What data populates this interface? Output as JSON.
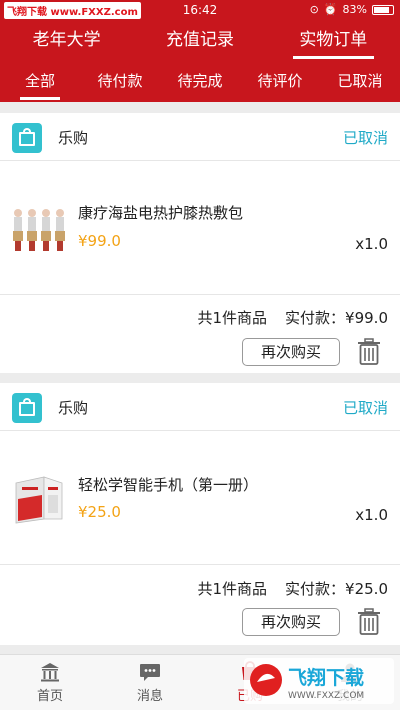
{
  "status_bar": {
    "watermark": "飞翔下载 www.FXXZ.com",
    "time": "16:42",
    "battery": "83%",
    "battery_level": 0.83
  },
  "top_tabs": [
    {
      "label": "老年大学"
    },
    {
      "label": "充值记录"
    },
    {
      "label": "实物订单",
      "active": true
    }
  ],
  "sub_tabs": [
    {
      "label": "全部",
      "active": true
    },
    {
      "label": "待付款"
    },
    {
      "label": "待完成"
    },
    {
      "label": "待评价"
    },
    {
      "label": "已取消"
    }
  ],
  "orders": [
    {
      "shop": "乐购",
      "status": "已取消",
      "item_title": "康疗海盐电热护膝热敷包",
      "item_price": "¥99.0",
      "item_qty": "x1.0",
      "count_text": "共1件商品",
      "paid_text": "实付款：¥99.0",
      "rebuy_label": "再次购买"
    },
    {
      "shop": "乐购",
      "status": "已取消",
      "item_title": "轻松学智能手机（第一册）",
      "item_price": "¥25.0",
      "item_qty": "x1.0",
      "count_text": "共1件商品",
      "paid_text": "实付款：¥25.0",
      "rebuy_label": "再次购买"
    }
  ],
  "bottom_nav": [
    {
      "label": "首页",
      "icon": "home-icon"
    },
    {
      "label": "消息",
      "icon": "message-icon"
    },
    {
      "label": "已购",
      "icon": "purchased-icon",
      "active": true
    },
    {
      "label": "我的",
      "icon": "profile-icon"
    }
  ],
  "bottom_watermark": "飞翔下载 WWW.FXXZ.COM",
  "colors": {
    "brand_red": "#c8161d",
    "status_teal": "#20aac7",
    "price_orange": "#f3a316",
    "shop_icon": "#33c1cf"
  }
}
